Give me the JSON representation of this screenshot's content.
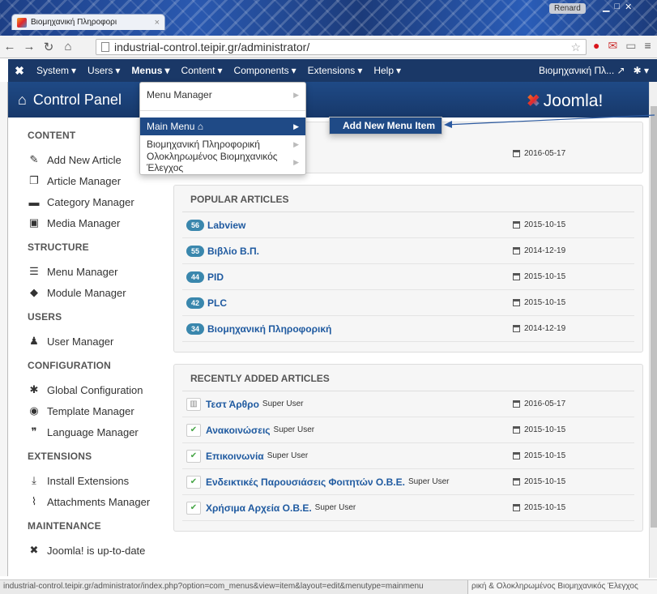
{
  "browser": {
    "tab_title": "Βιομηχανική Πληροφορι",
    "tab_close": "×",
    "profile": "Renard",
    "url": "industrial-control.teipir.gr/administrator/",
    "status_url": "industrial-control.teipir.gr/administrator/index.php?option=com_menus&view=item&layout=edit&menutype=mainmenu",
    "footer_text": "ρική & Ολοκληρωμένος Βιομηχανικός Έλεγχος"
  },
  "topbar": {
    "menus": [
      {
        "label": "System"
      },
      {
        "label": "Users"
      },
      {
        "label": "Menus"
      },
      {
        "label": "Content"
      },
      {
        "label": "Components"
      },
      {
        "label": "Extensions"
      },
      {
        "label": "Help"
      }
    ],
    "site_name": "Βιομηχανική Πλ..."
  },
  "header": {
    "title": "Control Panel",
    "logo": "Joomla!"
  },
  "dropdown": {
    "items": [
      {
        "label": "Menu Manager"
      },
      {
        "label": "Main Menu"
      },
      {
        "label": "Βιομηχανική Πληροφορική"
      },
      {
        "label": "Ολοκληρωμένος Βιομηχανικός Έλεγχος"
      }
    ],
    "submenu_label": "Add New Menu Item"
  },
  "sidebar": {
    "sections": [
      {
        "title": "CONTENT",
        "items": [
          {
            "label": "Add New Article",
            "icon": "pencil-icon",
            "glyph": "✎"
          },
          {
            "label": "Article Manager",
            "icon": "stack-icon",
            "glyph": "❐"
          },
          {
            "label": "Category Manager",
            "icon": "folder-icon",
            "glyph": "▬"
          },
          {
            "label": "Media Manager",
            "icon": "image-icon",
            "glyph": "▣"
          }
        ]
      },
      {
        "title": "STRUCTURE",
        "items": [
          {
            "label": "Menu Manager",
            "icon": "list-icon",
            "glyph": "☰"
          },
          {
            "label": "Module Manager",
            "icon": "cube-icon",
            "glyph": "◆"
          }
        ]
      },
      {
        "title": "USERS",
        "items": [
          {
            "label": "User Manager",
            "icon": "users-icon",
            "glyph": "♟"
          }
        ]
      },
      {
        "title": "CONFIGURATION",
        "items": [
          {
            "label": "Global Configuration",
            "icon": "cog-icon",
            "glyph": "✱"
          },
          {
            "label": "Template Manager",
            "icon": "eye-icon",
            "glyph": "◉"
          },
          {
            "label": "Language Manager",
            "icon": "comments-icon",
            "glyph": "❞"
          }
        ]
      },
      {
        "title": "EXTENSIONS",
        "items": [
          {
            "label": "Install Extensions",
            "icon": "upload-icon",
            "glyph": "⤓"
          },
          {
            "label": "Attachments Manager",
            "icon": "paperclip-icon",
            "glyph": "⌇"
          }
        ]
      },
      {
        "title": "MAINTENANCE",
        "items": [
          {
            "label": "Joomla! is up-to-date",
            "icon": "joomla-icon",
            "glyph": "✖"
          }
        ]
      }
    ]
  },
  "panels": {
    "first_date": "2016-05-17",
    "popular": {
      "title": "POPULAR ARTICLES",
      "rows": [
        {
          "hits": "56",
          "title": "Labview",
          "date": "2015-10-15"
        },
        {
          "hits": "55",
          "title": "Βιβλίο Β.Π.",
          "date": "2014-12-19"
        },
        {
          "hits": "44",
          "title": "PID",
          "date": "2015-10-15"
        },
        {
          "hits": "42",
          "title": "PLC",
          "date": "2015-10-15"
        },
        {
          "hits": "34",
          "title": "Βιομηχανική Πληροφορική",
          "date": "2014-12-19"
        }
      ]
    },
    "recent": {
      "title": "RECENTLY ADDED ARTICLES",
      "rows": [
        {
          "status": "trashed",
          "title": "Τεστ Άρθρο",
          "author": "Super User",
          "date": "2016-05-17"
        },
        {
          "status": "published",
          "title": "Ανακοινώσεις",
          "author": "Super User",
          "date": "2015-10-15"
        },
        {
          "status": "published",
          "title": "Επικοινωνία",
          "author": "Super User",
          "date": "2015-10-15"
        },
        {
          "status": "published",
          "title": "Ενδεικτικές Παρουσιάσεις Φοιτητών Ο.Β.Ε.",
          "author": "Super User",
          "date": "2015-10-15"
        },
        {
          "status": "published",
          "title": "Χρήσιμα Αρχεία Ο.Β.Ε.",
          "author": "Super User",
          "date": "2015-10-15"
        }
      ]
    }
  }
}
